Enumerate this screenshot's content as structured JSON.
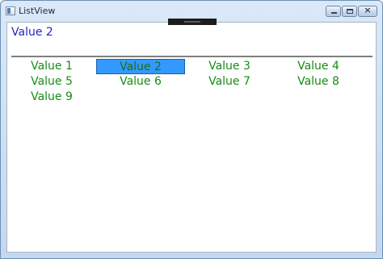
{
  "window": {
    "title": "ListView"
  },
  "header": {
    "selected_value": "Value 2"
  },
  "list": {
    "items": [
      {
        "label": "Value 1",
        "selected": false
      },
      {
        "label": "Value 2",
        "selected": true
      },
      {
        "label": "Value 3",
        "selected": false
      },
      {
        "label": "Value 4",
        "selected": false
      },
      {
        "label": "Value 5",
        "selected": false
      },
      {
        "label": "Value 6",
        "selected": false
      },
      {
        "label": "Value 7",
        "selected": false
      },
      {
        "label": "Value 8",
        "selected": false
      },
      {
        "label": "Value 9",
        "selected": false
      }
    ]
  },
  "colors": {
    "item_text": "#168c16",
    "selected_background": "#3399ff",
    "header_text": "#2323c8"
  },
  "icons": {
    "app": "window-app-icon",
    "minimize": "minimize-icon",
    "maximize": "maximize-icon",
    "close": "close-icon"
  }
}
